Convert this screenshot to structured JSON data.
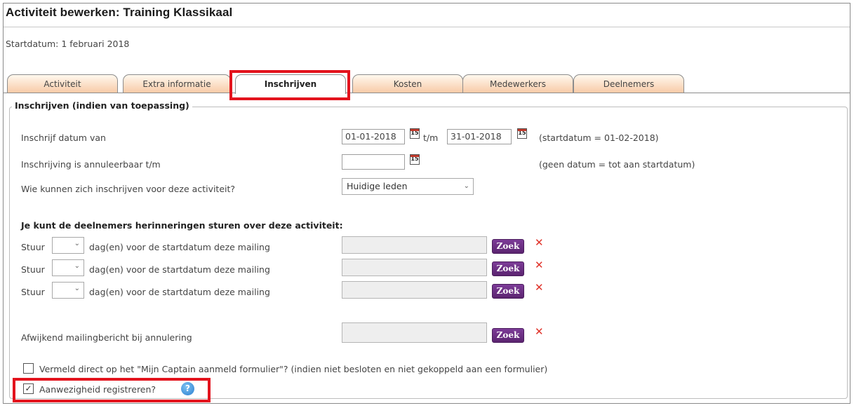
{
  "page": {
    "title": "Activiteit bewerken: Training Klassikaal",
    "startdate_text": "Startdatum: 1 februari 2018"
  },
  "tabs": [
    {
      "label": "Activiteit",
      "active": false
    },
    {
      "label": "Extra informatie",
      "active": false
    },
    {
      "label": "Inschrijven",
      "active": true
    },
    {
      "label": "Kosten",
      "active": false
    },
    {
      "label": "Medewerkers",
      "active": false
    },
    {
      "label": "Deelnemers",
      "active": false
    }
  ],
  "section": {
    "legend": "Inschrijven (indien van toepassing)",
    "date_from_label": "Inschrijf datum van",
    "date_from_value": "01-01-2018",
    "date_sep": "t/m",
    "date_to_value": "31-01-2018",
    "date_note": "(startdatum = 01-02-2018)",
    "cancel_label": "Inschrijving is annuleerbaar t/m",
    "cancel_value": "",
    "cancel_note": "(geen datum = tot aan startdatum)",
    "who_label": "Wie kunnen zich inschrijven voor deze activiteit?",
    "who_value": "Huidige leden",
    "calendar_glyph": "15"
  },
  "reminders": {
    "heading": "Je kunt de deelnemers herinneringen sturen over deze activiteit:",
    "rows": [
      {
        "prefix": "Stuur",
        "text": "dag(en) voor de startdatum deze mailing",
        "days": "",
        "mailing": ""
      },
      {
        "prefix": "Stuur",
        "text": "dag(en) voor de startdatum deze mailing",
        "days": "",
        "mailing": ""
      },
      {
        "prefix": "Stuur",
        "text": "dag(en) voor de startdatum deze mailing",
        "days": "",
        "mailing": ""
      }
    ],
    "zoek_label": "Zoek",
    "remove_glyph": "✕",
    "cancel_mail_label": "Afwijkend mailingbericht bij annulering",
    "cancel_mail_value": ""
  },
  "options": {
    "mention_label": "Vermeld direct op het \"Mijn Captain aanmeld formulier\"? (indien niet besloten en niet gekoppeld aan een formulier)",
    "mention_checked": false,
    "attendance_label": "Aanwezigheid registreren?",
    "attendance_checked": true,
    "check_glyph": "✓",
    "help_glyph": "?"
  },
  "colors": {
    "highlight": "#e3131d",
    "zoek_button": "#6a2d82",
    "remove_icon": "#e0332a",
    "tab_gradient_bottom": "#f8cba8"
  }
}
